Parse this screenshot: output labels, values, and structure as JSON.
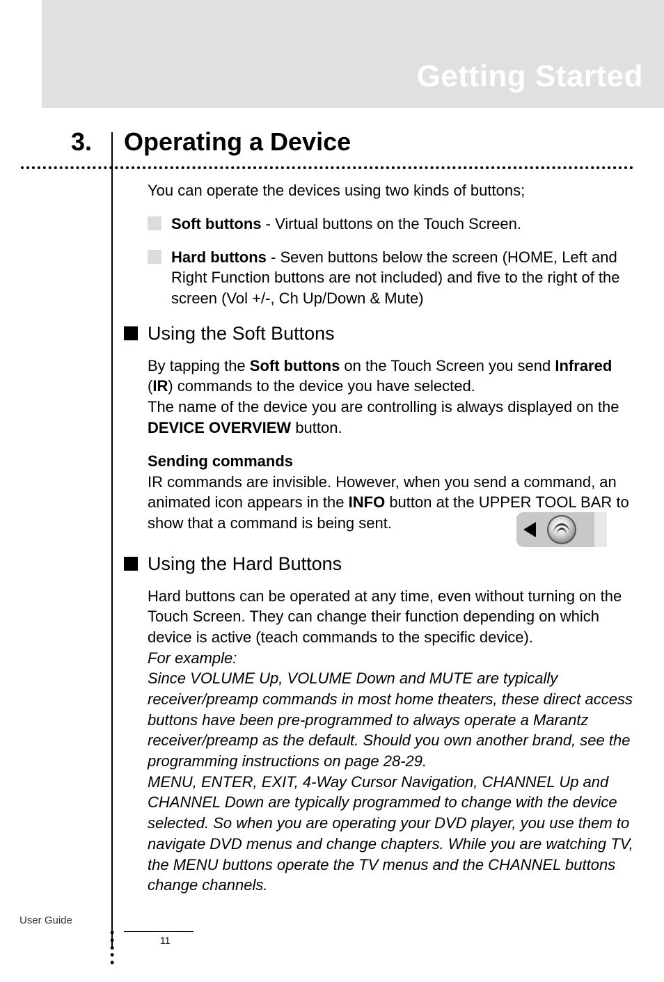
{
  "header": {
    "title": "Getting Started"
  },
  "section": {
    "number": "3.",
    "title": "Operating a Device"
  },
  "intro": "You can operate the devices using two kinds of buttons;",
  "bullets": [
    {
      "bold": "Soft buttons",
      "rest": " - Virtual buttons on the Touch Screen."
    },
    {
      "bold": "Hard buttons",
      "rest": " - Seven buttons below the screen (HOME, Left and Right Function buttons are not included) and five to the right of the screen (Vol +/-, Ch Up/Down & Mute)"
    }
  ],
  "sub1": {
    "heading": "Using the Soft Buttons",
    "para_parts": {
      "p1a": "By tapping the ",
      "p1b": "Soft buttons",
      "p1c": " on the Touch Screen you send ",
      "p1d": "Infrared",
      "p1e": " (",
      "p1f": "IR",
      "p1g": ") commands to the device you have selected.",
      "p2a": "The name of the device you are controlling is always displayed on the ",
      "p2b": "DEVICE OVERVIEW",
      "p2c": " button."
    },
    "sending_heading": "Sending commands",
    "sending_parts": {
      "a": "IR commands are invisible. However, when you send a command, an animated icon appears in the ",
      "b": "INFO",
      "c": " button at the UPPER TOOL BAR to show that a command is being sent."
    }
  },
  "sub2": {
    "heading": "Using the Hard Buttons",
    "para1": "Hard buttons can be operated at any time, even without turning on the Touch Screen. They can change their function depending on which device is active (teach commands to the specific device).",
    "example_label": "For example:",
    "example_body1": "Since VOLUME Up, VOLUME Down and MUTE are typically receiver/preamp commands in most home theaters, these direct access buttons have been pre-programmed to always operate a Marantz receiver/preamp as the default. Should you own another brand, see the programming instructions on page 28-29.",
    "example_body2": "MENU, ENTER, EXIT, 4-Way Cursor Navigation, CHANNEL Up and CHANNEL Down are typically programmed to change with the device selected. So when you are operating your DVD player, you use them to navigate DVD menus and change chapters. While you are watching TV, the MENU buttons operate the TV menus and the CHANNEL buttons change channels."
  },
  "footer": {
    "label": "User Guide",
    "page": "11"
  }
}
